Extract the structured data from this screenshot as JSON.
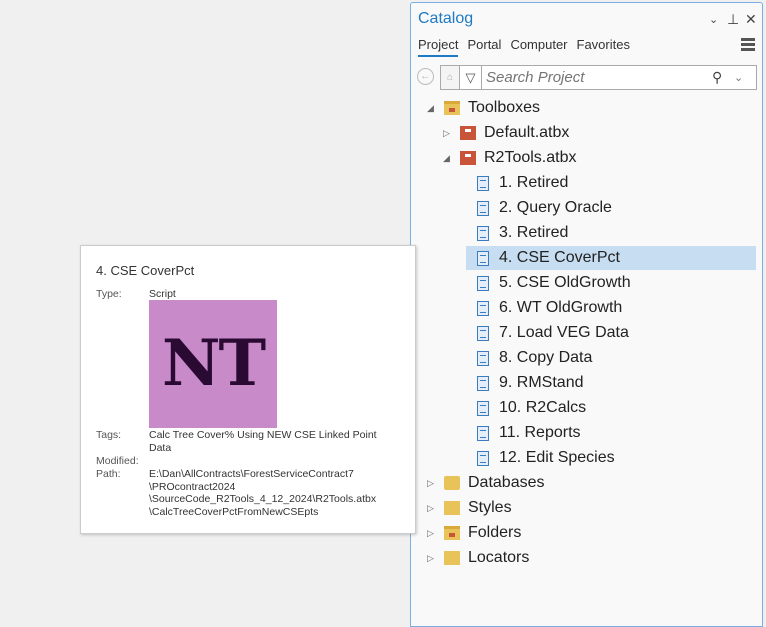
{
  "catalog": {
    "title": "Catalog",
    "tabs": [
      "Project",
      "Portal",
      "Computer",
      "Favorites"
    ],
    "search_placeholder": "Search Project",
    "tree": [
      {
        "label": "Toolboxes",
        "level": 0,
        "icon": "folder",
        "expanded": true
      },
      {
        "label": "Default.atbx",
        "level": 1,
        "icon": "toolbox",
        "expanded": false
      },
      {
        "label": "R2Tools.atbx",
        "level": 1,
        "icon": "toolbox",
        "expanded": true
      },
      {
        "label": "1.  Retired",
        "level": 2,
        "icon": "script"
      },
      {
        "label": "2.  Query Oracle",
        "level": 2,
        "icon": "script"
      },
      {
        "label": "3.  Retired",
        "level": 2,
        "icon": "script"
      },
      {
        "label": "4.  CSE CoverPct",
        "level": 2,
        "icon": "script",
        "selected": true
      },
      {
        "label": "5.  CSE OldGrowth",
        "level": 2,
        "icon": "script"
      },
      {
        "label": "6.  WT OldGrowth",
        "level": 2,
        "icon": "script"
      },
      {
        "label": "7.  Load VEG Data",
        "level": 2,
        "icon": "script"
      },
      {
        "label": "8.  Copy Data",
        "level": 2,
        "icon": "script"
      },
      {
        "label": "9.  RMStand",
        "level": 2,
        "icon": "script"
      },
      {
        "label": "10. R2Calcs",
        "level": 2,
        "icon": "script"
      },
      {
        "label": "11. Reports",
        "level": 2,
        "icon": "script"
      },
      {
        "label": "12. Edit Species",
        "level": 2,
        "icon": "script"
      },
      {
        "label": "Databases",
        "level": 0,
        "icon": "database",
        "expanded": false
      },
      {
        "label": "Styles",
        "level": 0,
        "icon": "style",
        "expanded": false
      },
      {
        "label": "Folders",
        "level": 0,
        "icon": "folder",
        "expanded": false
      },
      {
        "label": "Locators",
        "level": 0,
        "icon": "locator",
        "expanded": false
      }
    ]
  },
  "tooltip": {
    "title": "4.  CSE CoverPct",
    "type_label": "Type:",
    "type": "Script",
    "thumbnail_text": "NT",
    "tags_label": "Tags:",
    "tags": "Calc Tree Cover% Using NEW CSE Linked Point Data",
    "modified_label": "Modified:",
    "path_label": "Path:",
    "path_lines": [
      "E:\\Dan\\AllContracts\\ForestServiceContract7",
      "\\PROcontract2024",
      "\\SourceCode_R2Tools_4_12_2024\\R2Tools.atbx",
      "\\CalcTreeCoverPctFromNewCSEpts"
    ]
  }
}
